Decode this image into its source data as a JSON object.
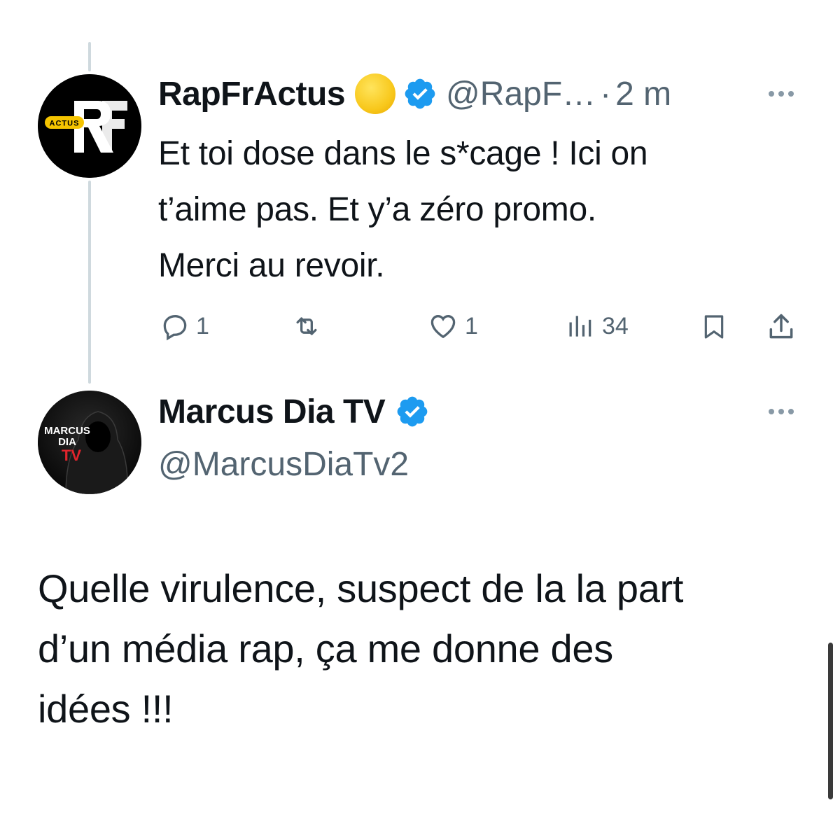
{
  "parent_tweet": {
    "display_name": "RapFrActus",
    "handle": "@RapF…",
    "separator": "·",
    "time": "2 m",
    "avatar_text": "ACTUS",
    "text_lines": [
      "Et toi dose dans le s*cage ! Ici on",
      "t’aime pas. Et y’a zéro promo.",
      "Merci au revoir."
    ],
    "actions": {
      "reply_count": "1",
      "like_count": "1",
      "views_count": "34"
    }
  },
  "reply_tweet": {
    "display_name": "Marcus Dia TV",
    "handle": "@MarcusDiaTv2",
    "avatar_text_line1": "MARCUS",
    "avatar_text_line2": "DIA",
    "avatar_text_line3": "TV",
    "text_lines": [
      "Quelle virulence, suspect de la la part",
      "d’un média rap, ça me donne des",
      "idées !!!"
    ]
  },
  "colors": {
    "verified_blue": "#1d9bf0",
    "secondary_text": "#536471",
    "thread_line": "#cfd9de"
  }
}
